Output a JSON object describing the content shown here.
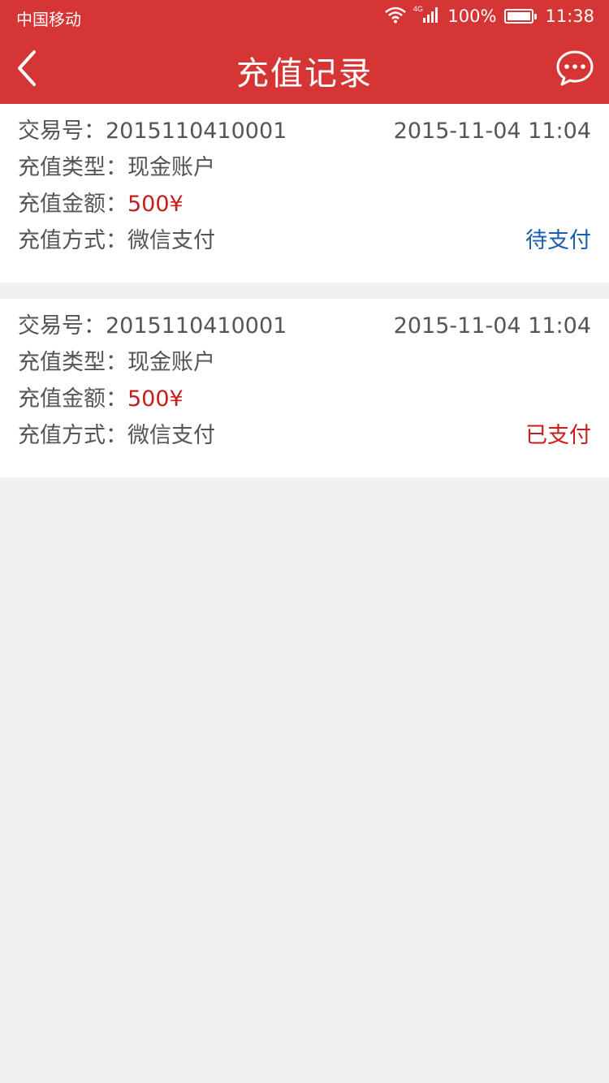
{
  "status_bar": {
    "carrier": "中国移动",
    "network": "4G",
    "battery": "100%",
    "time": "11:38"
  },
  "nav": {
    "title": "充值记录"
  },
  "labels": {
    "txn": "交易号：",
    "type": "充值类型：",
    "amount": "充值金额：",
    "method": "充值方式："
  },
  "records": [
    {
      "txn_no": "2015110410001",
      "datetime": "2015-11-04  11:04",
      "type": "现金账户",
      "amount": "500¥",
      "method": "微信支付",
      "status": "待支付"
    },
    {
      "txn_no": "2015110410001",
      "datetime": "2015-11-04  11:04",
      "type": "现金账户",
      "amount": "500¥",
      "method": "微信支付",
      "status": "已支付"
    }
  ],
  "colors": {
    "header": "#d63535",
    "pending": "#1a5fae",
    "paid": "#c81d1d",
    "amount": "#c81d1d"
  }
}
